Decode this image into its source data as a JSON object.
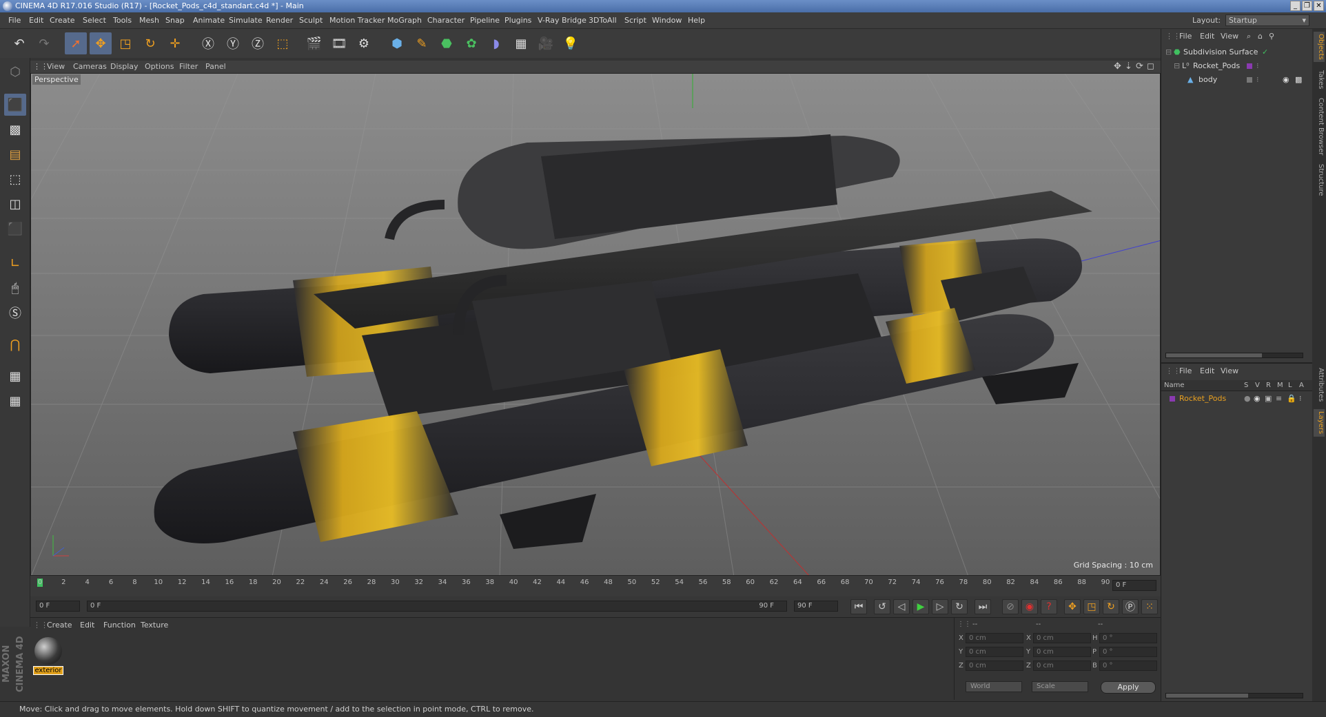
{
  "window": {
    "title": "CINEMA 4D R17.016 Studio (R17) - [Rocket_Pods_c4d_standart.c4d *] - Main"
  },
  "menubar": {
    "items": [
      "File",
      "Edit",
      "Create",
      "Select",
      "Tools",
      "Mesh",
      "Snap",
      "Animate",
      "Simulate",
      "Render",
      "Sculpt",
      "Motion Tracker",
      "MoGraph",
      "Character",
      "Pipeline",
      "Plugins",
      "V-Ray Bridge",
      "3DToAll",
      "Script",
      "Window",
      "Help"
    ],
    "layout_label": "Layout:",
    "layout_value": "Startup"
  },
  "viewport": {
    "menu": [
      "View",
      "Cameras",
      "Display",
      "Options",
      "Filter",
      "Panel"
    ],
    "camera": "Perspective",
    "grid_spacing": "Grid Spacing : 10 cm"
  },
  "timeline": {
    "ticks": [
      "0",
      "2",
      "4",
      "6",
      "8",
      "10",
      "12",
      "14",
      "16",
      "18",
      "20",
      "22",
      "24",
      "26",
      "28",
      "30",
      "32",
      "34",
      "36",
      "38",
      "40",
      "42",
      "44",
      "46",
      "48",
      "50",
      "52",
      "54",
      "56",
      "58",
      "60",
      "62",
      "64",
      "66",
      "68",
      "70",
      "72",
      "74",
      "76",
      "78",
      "80",
      "82",
      "84",
      "86",
      "88",
      "90"
    ],
    "current_frame": "0 F",
    "start_frame": "0 F",
    "range_start": "0 F",
    "range_end": "90 F",
    "end_frame": "90 F"
  },
  "material_manager": {
    "menu": [
      "Create",
      "Edit",
      "Function",
      "Texture"
    ],
    "material_name": "exterior"
  },
  "coordinates": {
    "header": [
      "--",
      "--",
      "--"
    ],
    "rows": [
      {
        "axis1": "X",
        "val1": "0 cm",
        "axis2": "X",
        "val2": "0 cm",
        "axis3": "H",
        "val3": "0 °"
      },
      {
        "axis1": "Y",
        "val1": "0 cm",
        "axis2": "Y",
        "val2": "0 cm",
        "axis3": "P",
        "val3": "0 °"
      },
      {
        "axis1": "Z",
        "val1": "0 cm",
        "axis2": "Z",
        "val2": "0 cm",
        "axis3": "B",
        "val3": "0 °"
      }
    ],
    "mode": "World",
    "transform": "Scale",
    "apply_label": "Apply"
  },
  "object_manager": {
    "menu": [
      "File",
      "Edit",
      "View"
    ],
    "objects": [
      {
        "name": "Subdivision Surface",
        "color": "#c8c8c8"
      },
      {
        "name": "Rocket_Pods",
        "color": "#c8c8c8"
      },
      {
        "name": "body",
        "color": "#c8c8c8"
      }
    ]
  },
  "layer_manager": {
    "menu": [
      "File",
      "Edit",
      "View"
    ],
    "columns": [
      "Name",
      "S",
      "V",
      "R",
      "M",
      "L",
      "A"
    ],
    "layers": [
      {
        "name": "Rocket_Pods",
        "color": "#e8a020"
      }
    ]
  },
  "right_tabs": {
    "top": [
      "Objects",
      "Takes",
      "Content Browser",
      "Structure"
    ],
    "bottom": [
      "Attributes",
      "Layers"
    ]
  },
  "status_bar": {
    "text": "Move: Click and drag to move elements. Hold down SHIFT to quantize movement / add to the selection in point mode, CTRL to remove."
  },
  "brand": {
    "text": "MAXON CINEMA 4D"
  },
  "colors": {
    "accent": "#e8a020",
    "selection": "#566a8c",
    "rocket_stripe": "#e2b21c"
  }
}
